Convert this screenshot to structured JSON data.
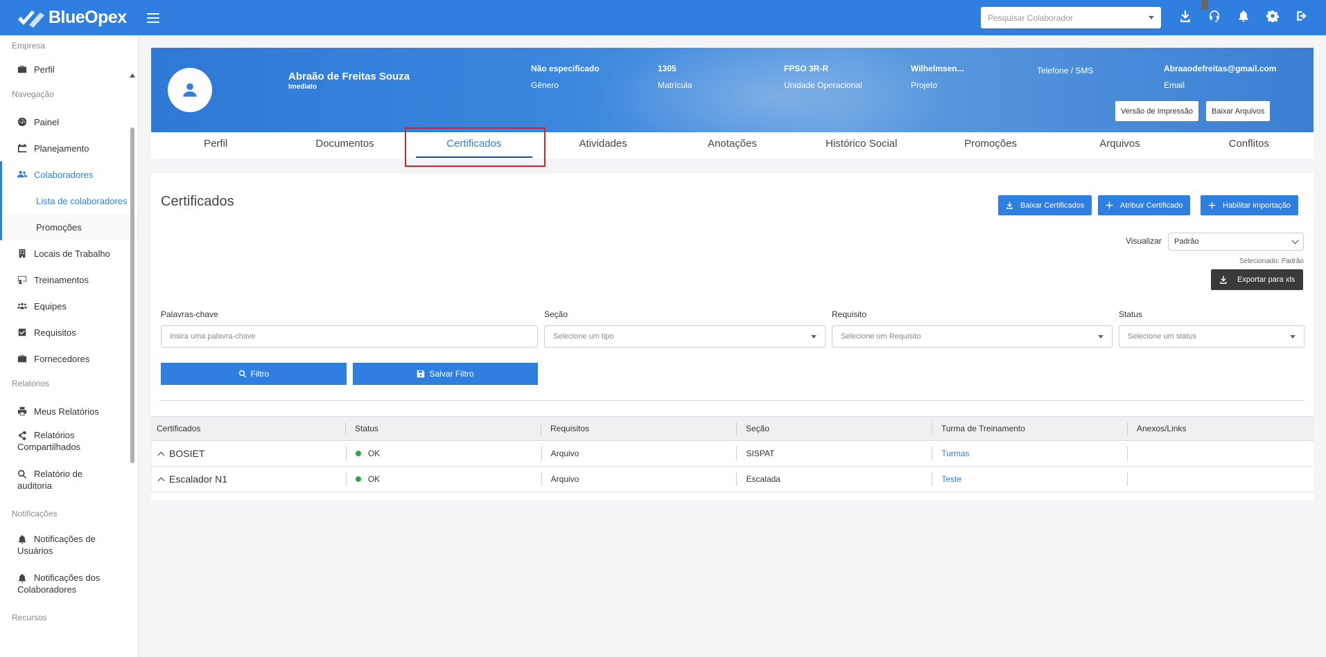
{
  "app": {
    "name": "BlueOpex"
  },
  "topbar": {
    "search_placeholder": "Pesquisar Colaborador",
    "icons": [
      "download-icon",
      "headset-icon",
      "bell-icon",
      "gear-icon",
      "logout-icon"
    ]
  },
  "sidebar": {
    "sections": {
      "empresa": "Empresa",
      "navegacao": "Navegação",
      "relatorios": "Relatórios",
      "notificacoes": "Notificações",
      "recursos": "Recursos"
    },
    "perfil": "Perfil",
    "painel": "Painel",
    "planejamento": "Planejamento",
    "colaboradores": "Colaboradores",
    "lista": "Lista de colaboradores",
    "promocoes": "Promoções",
    "locais": "Locais de Trabalho",
    "treinamentos": "Treinamentos",
    "equipes": "Equipes",
    "requisitos": "Requisitos",
    "fornecedores": "Fornecedores",
    "meus_relatorios": "Meus Relatórios",
    "rel_comp_1": "Relatórios",
    "rel_comp_2": "Compartilhados",
    "rel_aud_1": "Relatório de",
    "rel_aud_2": "auditoria",
    "not_usu_1": "Notificações de",
    "not_usu_2": "Usuários",
    "not_col_1": "Notificações dos",
    "not_col_2": "Colaboradores"
  },
  "profile": {
    "name": "Abraão de Freitas Souza",
    "role": "Imediato",
    "fields": [
      {
        "value": "Não especificado",
        "label": "Gênero"
      },
      {
        "value": "1305",
        "label": "Matrícula"
      },
      {
        "value": "FPSO 3R-R",
        "label": "Unidade Operacional"
      },
      {
        "value": "Wilhelmsen...",
        "label": "Projeto"
      },
      {
        "value": "",
        "label": "Telefone / SMS"
      },
      {
        "value": "Abraaodefreitas@gmail.com",
        "label": "Email"
      }
    ],
    "print_button": "Versão de Impressão",
    "download_files_button": "Baixar Arquivos"
  },
  "tabs": [
    "Perfil",
    "Documentos",
    "Certificados",
    "Atividades",
    "Anotações",
    "Histórico Social",
    "Promoções",
    "Arquivos",
    "Conflitos"
  ],
  "active_tab": "Certificados",
  "certificates": {
    "title": "Certificados",
    "btn_download": "Baixar Certificados",
    "btn_assign": "Atribuir Certificado",
    "btn_import": "Habilitar importação",
    "view_label": "Visualizar",
    "view_value": "Padrão",
    "selected_note": "Selecionado: Padrão",
    "export_button": "Exportar para xls",
    "filters": {
      "keywords_label": "Palavras-chave",
      "keywords_placeholder": "Insira uma palavra-chave",
      "section_label": "Seção",
      "section_placeholder": "Selecione um tipo",
      "requirement_label": "Requisito",
      "requirement_placeholder": "Selecione um Requisito",
      "status_label": "Status",
      "status_placeholder": "Selecione um status",
      "filter_button": "Filtro",
      "save_button": "Salvar Filtro"
    },
    "table": {
      "headers": [
        "Certificados",
        "Status",
        "Requisitos",
        "Seção",
        "Turma de Treinamento",
        "Anexos/Links"
      ],
      "rows": [
        {
          "name": "BOSIET",
          "status": "OK",
          "requirement": "Arquivo",
          "section": "SISPAT",
          "class": "Turmas",
          "attachments": ""
        },
        {
          "name": "Escalador N1",
          "status": "OK",
          "requirement": "Arquivo",
          "section": "Escalada",
          "class": "Teste",
          "attachments": ""
        }
      ]
    }
  },
  "colors": {
    "primary": "#2e7fdf",
    "dark_button": "#3a3a3a",
    "status_ok": "#28a745",
    "highlight": "#e02020"
  }
}
